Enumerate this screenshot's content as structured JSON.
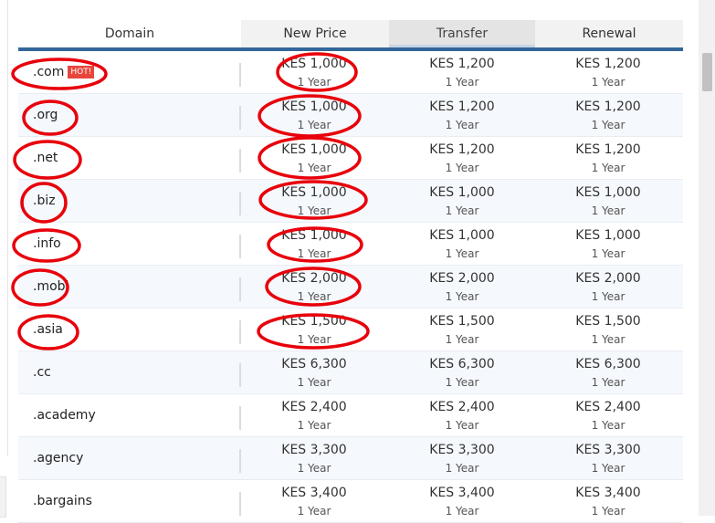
{
  "table": {
    "headers": {
      "domain": "Domain",
      "new_price": "New Price",
      "transfer": "Transfer",
      "renewal": "Renewal"
    },
    "rows": [
      {
        "tld": ".com",
        "badge": "HOT!",
        "new_price": "KES 1,000",
        "new_period": "1 Year",
        "transfer": "KES 1,200",
        "transfer_period": "1 Year",
        "renewal": "KES 1,200",
        "renewal_period": "1 Year"
      },
      {
        "tld": ".org",
        "badge": "",
        "new_price": "KES 1,000",
        "new_period": "1 Year",
        "transfer": "KES 1,200",
        "transfer_period": "1 Year",
        "renewal": "KES 1,200",
        "renewal_period": "1 Year"
      },
      {
        "tld": ".net",
        "badge": "",
        "new_price": "KES 1,000",
        "new_period": "1 Year",
        "transfer": "KES 1,200",
        "transfer_period": "1 Year",
        "renewal": "KES 1,200",
        "renewal_period": "1 Year"
      },
      {
        "tld": ".biz",
        "badge": "",
        "new_price": "KES 1,000",
        "new_period": "1 Year",
        "transfer": "KES 1,000",
        "transfer_period": "1 Year",
        "renewal": "KES 1,000",
        "renewal_period": "1 Year"
      },
      {
        "tld": ".info",
        "badge": "",
        "new_price": "KES 1,000",
        "new_period": "1 Year",
        "transfer": "KES 1,000",
        "transfer_period": "1 Year",
        "renewal": "KES 1,000",
        "renewal_period": "1 Year"
      },
      {
        "tld": ".mobi",
        "badge": "",
        "new_price": "KES 2,000",
        "new_period": "1 Year",
        "transfer": "KES 2,000",
        "transfer_period": "1 Year",
        "renewal": "KES 2,000",
        "renewal_period": "1 Year"
      },
      {
        "tld": ".asia",
        "badge": "",
        "new_price": "KES 1,500",
        "new_period": "1 Year",
        "transfer": "KES 1,500",
        "transfer_period": "1 Year",
        "renewal": "KES 1,500",
        "renewal_period": "1 Year"
      },
      {
        "tld": ".cc",
        "badge": "",
        "new_price": "KES 6,300",
        "new_period": "1 Year",
        "transfer": "KES 6,300",
        "transfer_period": "1 Year",
        "renewal": "KES 6,300",
        "renewal_period": "1 Year"
      },
      {
        "tld": ".academy",
        "badge": "",
        "new_price": "KES 2,400",
        "new_period": "1 Year",
        "transfer": "KES 2,400",
        "transfer_period": "1 Year",
        "renewal": "KES 2,400",
        "renewal_period": "1 Year"
      },
      {
        "tld": ".agency",
        "badge": "",
        "new_price": "KES 3,300",
        "new_period": "1 Year",
        "transfer": "KES 3,300",
        "transfer_period": "1 Year",
        "renewal": "KES 3,300",
        "renewal_period": "1 Year"
      },
      {
        "tld": ".bargains",
        "badge": "",
        "new_price": "KES 3,400",
        "new_period": "1 Year",
        "transfer": "KES 3,400",
        "transfer_period": "1 Year",
        "renewal": "KES 3,400",
        "renewal_period": "1 Year"
      }
    ]
  },
  "annotations": {
    "color": "#e8000b",
    "circled_rows": [
      0,
      1,
      2,
      3,
      4,
      5,
      6
    ]
  }
}
